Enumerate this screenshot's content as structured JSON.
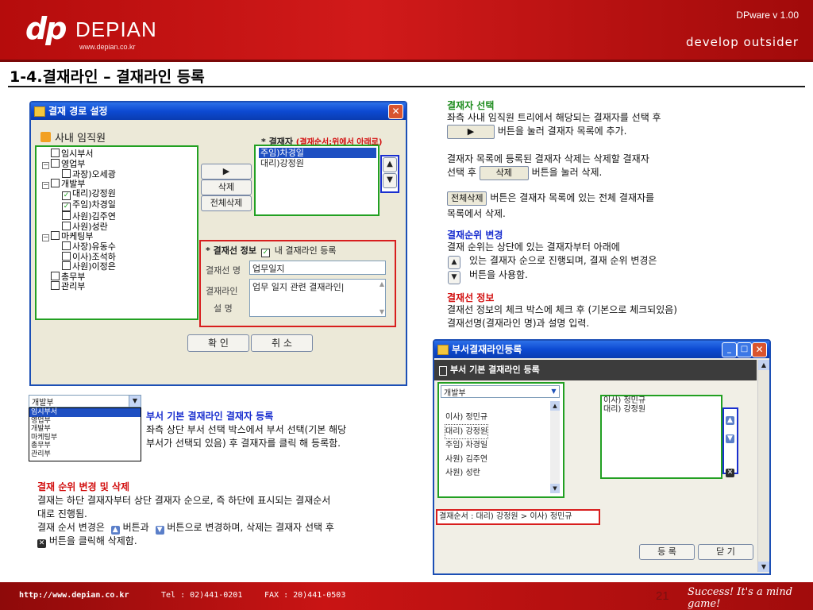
{
  "header": {
    "logo_mark": "dp",
    "logo_name": "DEPIAN",
    "logo_url": "www.depian.co.kr",
    "version": "DPware v 1.00",
    "tagline": "develop outsider"
  },
  "page_title": "1-4.결재라인 – 결재라인 등록",
  "dialog1": {
    "title": "결재 경로 설정",
    "tree_heading": "사내 임직원",
    "tree": [
      {
        "label": "임시부서",
        "level": 0,
        "expander": "",
        "checked": false
      },
      {
        "label": "영업부",
        "level": 0,
        "expander": "−",
        "checked": false
      },
      {
        "label": "과장)오세광",
        "level": 1,
        "expander": "",
        "checked": false
      },
      {
        "label": "개발부",
        "level": 0,
        "expander": "−",
        "checked": false
      },
      {
        "label": "대리)강정원",
        "level": 1,
        "expander": "",
        "checked": true
      },
      {
        "label": "주임)차경일",
        "level": 1,
        "expander": "",
        "checked": true
      },
      {
        "label": "사원)김주연",
        "level": 1,
        "expander": "",
        "checked": false
      },
      {
        "label": "사원)성란",
        "level": 1,
        "expander": "",
        "checked": false
      },
      {
        "label": "마케팅부",
        "level": 0,
        "expander": "−",
        "checked": false
      },
      {
        "label": "사장)유동수",
        "level": 1,
        "expander": "",
        "checked": false
      },
      {
        "label": "이사)조석하",
        "level": 1,
        "expander": "",
        "checked": false
      },
      {
        "label": "사원)이정은",
        "level": 1,
        "expander": "",
        "checked": false
      },
      {
        "label": "총무부",
        "level": 0,
        "expander": "",
        "checked": false
      },
      {
        "label": "관리부",
        "level": 0,
        "expander": "",
        "checked": false
      }
    ],
    "approver_label": "* 결재자",
    "approver_note": "(결재순서:위에서 아래로)",
    "approvers": [
      "주임)차경일",
      "대리)강정원"
    ],
    "add_button": "▶",
    "delete_button": "삭제",
    "delete_all_button": "전체삭제",
    "line_info_label": "* 결재선 정보",
    "my_line_checkbox_label": "내 결재라인 등록",
    "line_name_label": "결재선 명",
    "line_name_value": "업무일지",
    "line_desc_label_1": "결재라인",
    "line_desc_label_2": "설 명",
    "line_desc_value": "업무 일지 관련 결재라인|",
    "ok_button": "확 인",
    "cancel_button": "취 소"
  },
  "dept_dropdown": {
    "selected": "개발부",
    "options": [
      "임시부서",
      "영업부",
      "개발부",
      "마케팅부",
      "총무부",
      "관리부"
    ],
    "highlighted": "임시부서"
  },
  "mid_text": {
    "title": "부서 기본 결재라인 결재자 등록",
    "lines": [
      "좌측 상단 부서 선택 박스에서 부서 선택(기본 해당",
      "부서가 선택되 있음) 후 결재자를 클릭 해 등록함."
    ]
  },
  "left_text": {
    "title": "결재 순위 변경 및 삭제",
    "line1": "결재는 하단 결재자부터 상단 결재자 순으로, 즉 하단에 표시되는 결재순서",
    "line2": "대로 진행됨.",
    "line3_a": "결재 순서 변경은",
    "line3_b": "버튼과",
    "line3_c": "버튼으로 변경하며, 삭제는 결재자 선택 후",
    "line4": "버튼을 클릭해 삭제함."
  },
  "right_text": {
    "s1_title": "결재자 선택",
    "s1_line1": "좌측 사내 임직원 트리에서 해당되는 결재자를 선택 후",
    "s1_btn": "▶",
    "s1_line2": "버튼을 눌러 결재자 목록에 추가.",
    "s1_line3": "결재자 목록에 등록된 결재자 삭제는 삭제할 결재자",
    "s1_line4_a": "선택 후",
    "s1_line4_btn": "삭제",
    "s1_line4_b": "버튼을 눌러 삭제.",
    "s1_btn2": "전체삭제",
    "s1_line5": "버튼은 결재자 목록에 있는 전체 결재자를",
    "s1_line6": "목록에서 삭제.",
    "s2_title": "결재순위 변경",
    "s2_line1": "결재 순위는 상단에 있는 결재자부터 아래에",
    "s2_line2": "있는 결재자 순으로 진행되며, 결재 순위 변경은",
    "s2_line3": "버튼을 사용함.",
    "s3_title": "결재선 정보",
    "s3_line1": "결재선 정보의 체크 박스에 체크 후 (기본으로 체크되있음)",
    "s3_line2": "결재선명(결재라인 명)과 설명 입력."
  },
  "dialog2": {
    "title": "부서결재라인등록",
    "section_title": "부서 기본 결재라인 등록",
    "dept_selected": "개발부",
    "members": [
      "이사) 정민규",
      "대리) 강정원",
      "주임) 차경일",
      "사원) 김주연",
      "사원) 성란"
    ],
    "approvers": [
      "이사) 정민규",
      "대리) 강정원"
    ],
    "order_label": "결재순서 : 대리) 강정원 > 이사) 정민규",
    "register_button": "등 록",
    "close_button": "닫 기"
  },
  "footer": {
    "url": "http://www.depian.co.kr",
    "tel": "Tel : 02)441-0201",
    "fax": "FAX : 20)441-0503",
    "page_number": "21",
    "slogan": "Success! It's a mind game!"
  }
}
